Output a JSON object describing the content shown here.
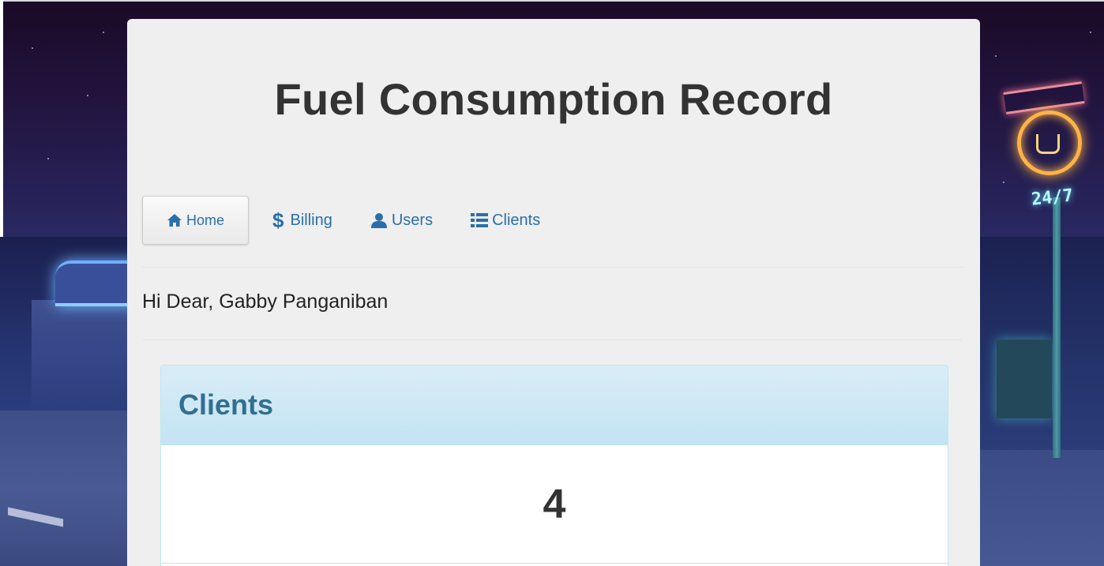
{
  "page": {
    "title": "Fuel Consumption Record"
  },
  "nav": {
    "items": [
      {
        "label": "Home",
        "icon": "home-icon",
        "active": true
      },
      {
        "label": "Billing",
        "icon": "dollar-icon",
        "active": false
      },
      {
        "label": "Users",
        "icon": "user-icon",
        "active": false
      },
      {
        "label": "Clients",
        "icon": "list-icon",
        "active": false
      }
    ]
  },
  "greeting": {
    "text": "Hi Dear, Gabby Panganiban"
  },
  "panel": {
    "title": "Clients",
    "count": "4"
  },
  "colors": {
    "link": "#2a6fa8",
    "panel_heading_bg": "#d9edf7",
    "panel_title": "#31708f",
    "card_bg": "#efefef"
  }
}
